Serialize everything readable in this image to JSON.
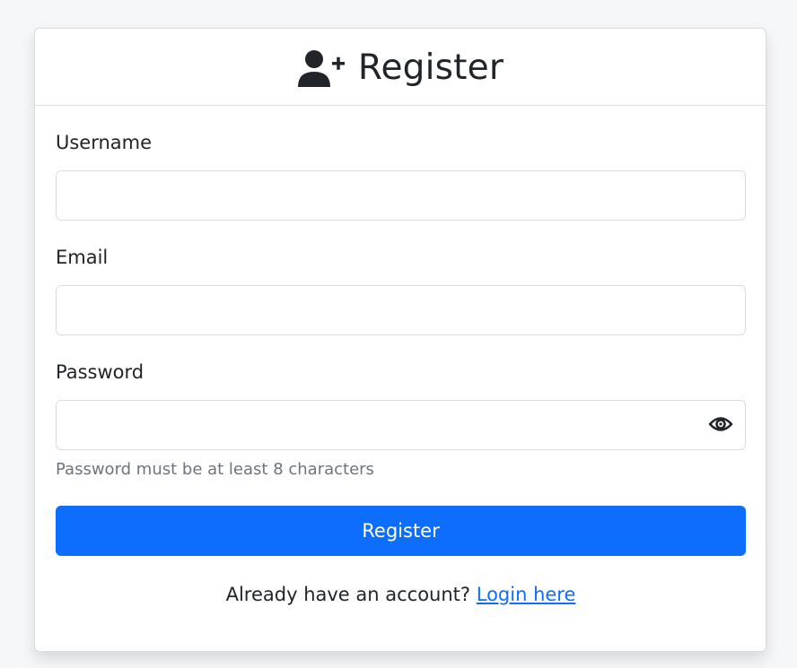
{
  "header": {
    "title": "Register",
    "icon": "user-plus-icon"
  },
  "form": {
    "username_label": "Username",
    "username_value": "",
    "email_label": "Email",
    "email_value": "",
    "password_label": "Password",
    "password_value": "",
    "password_help": "Password must be at least 8 characters",
    "submit_label": "Register"
  },
  "footer": {
    "prompt": "Already have an account?",
    "link_label": "Login here"
  },
  "colors": {
    "accent": "#0d6efd",
    "text": "#212529",
    "muted": "#6c757d",
    "border": "#d9dde2",
    "background": "#f6f7f9"
  }
}
